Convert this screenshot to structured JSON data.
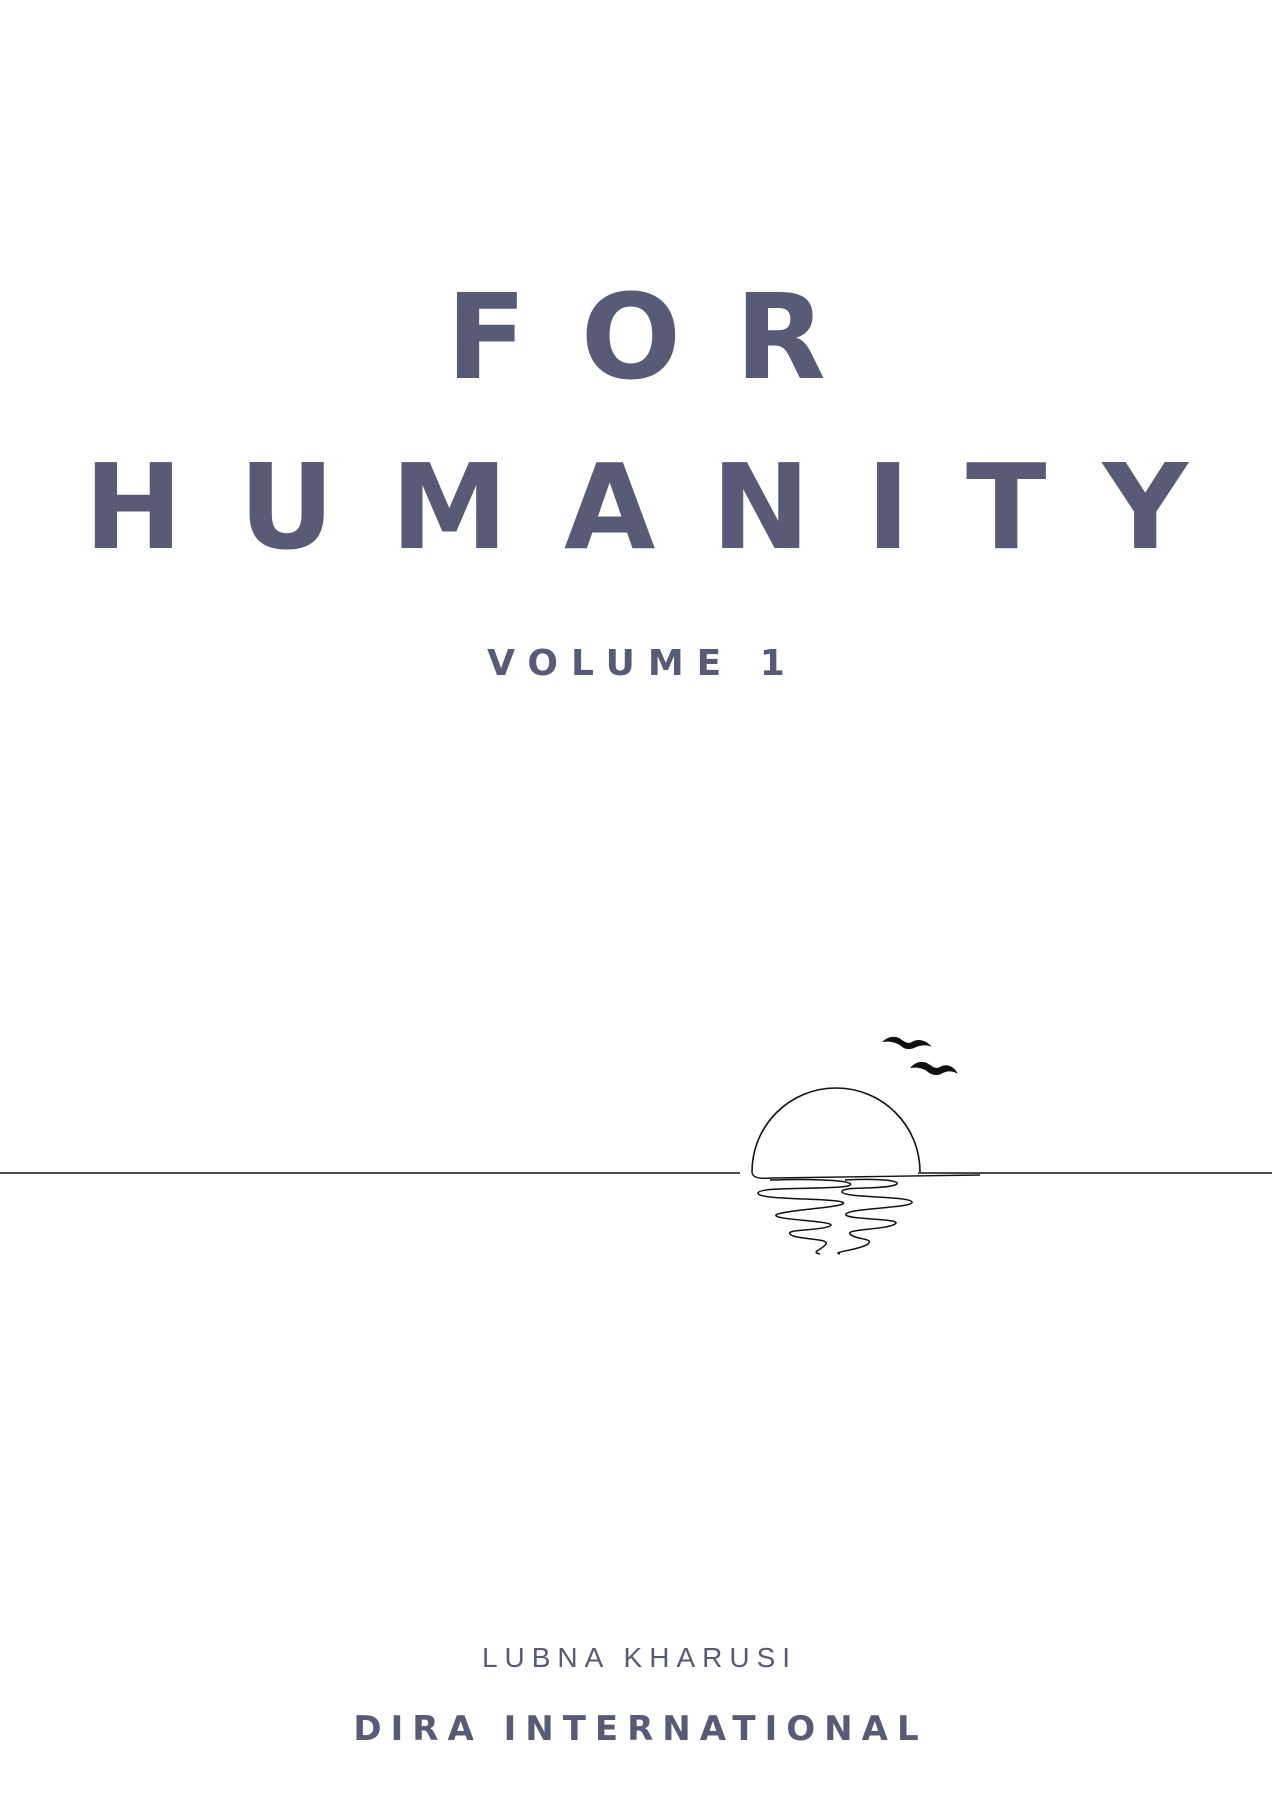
{
  "cover": {
    "title_line_1": "FOR",
    "title_line_2": "HUMANITY",
    "subtitle": "VOLUME 1",
    "author": "LUBNA KHARUSI",
    "publisher": "DIRA INTERNATIONAL"
  },
  "illustration": {
    "icon": "sunset-over-sea-line-art",
    "birds_icon": "flying-birds-icon"
  },
  "colors": {
    "text": "#585b75",
    "background": "#ffffff",
    "line_art": "#111111"
  }
}
